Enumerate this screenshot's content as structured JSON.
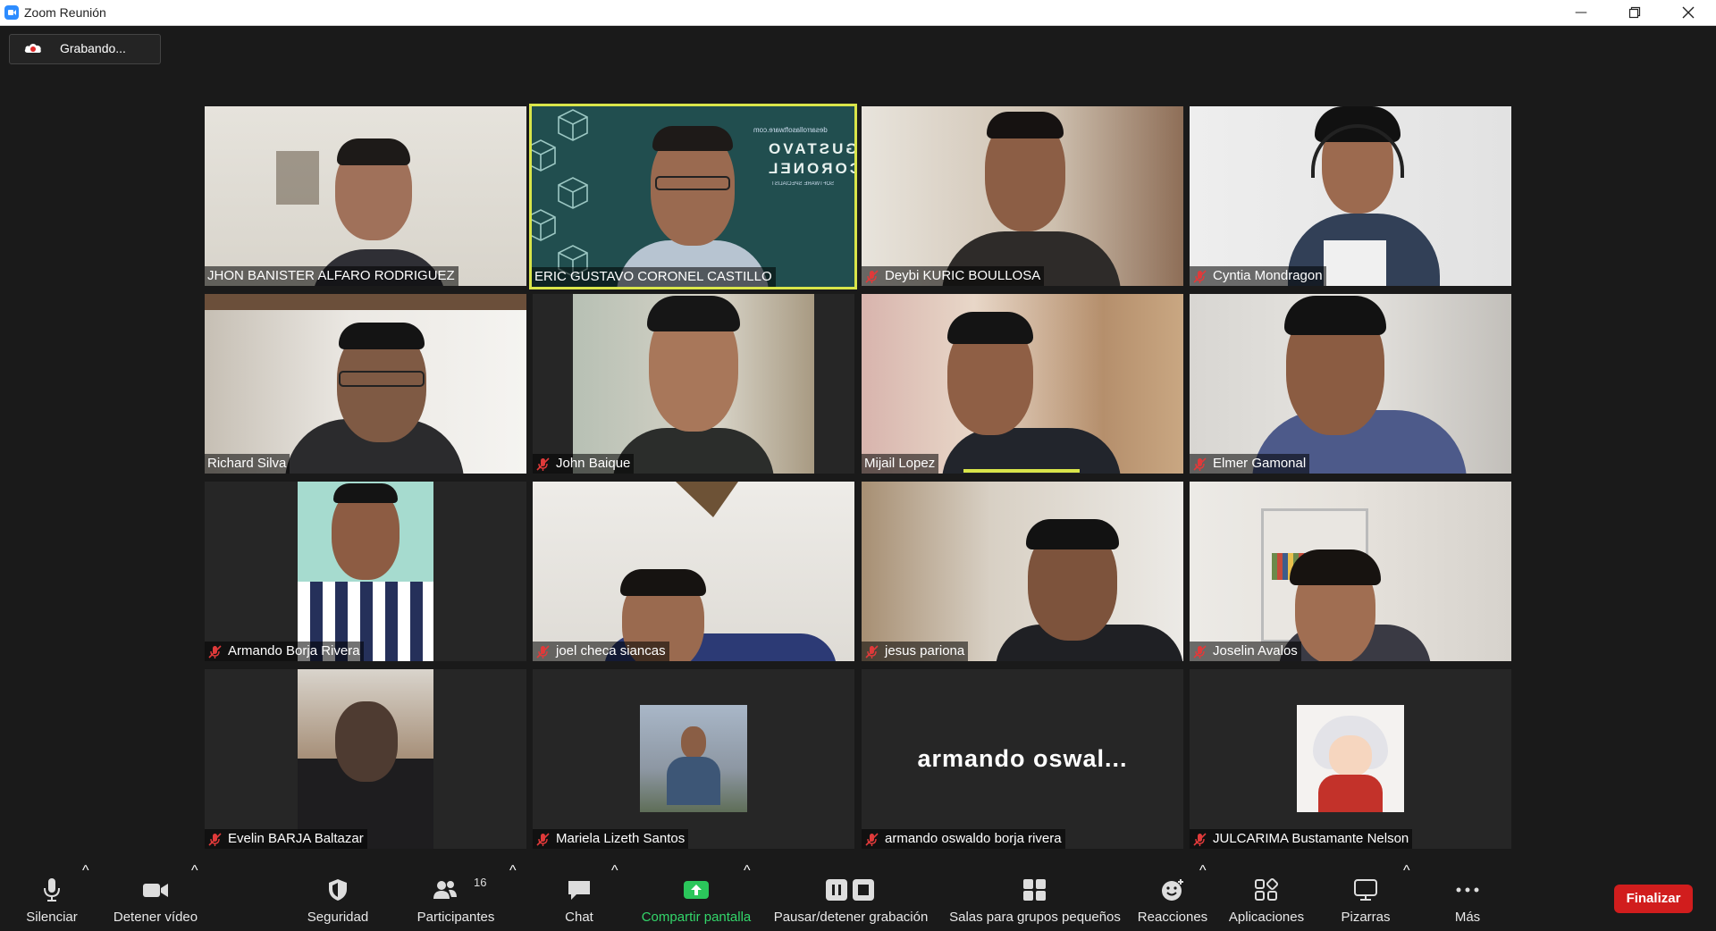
{
  "window": {
    "title": "Zoom Reunión"
  },
  "recording_badge": {
    "label": "Grabando..."
  },
  "participants": [
    {
      "name": "JHON BANISTER ALFARO RODRIGUEZ",
      "muted": false
    },
    {
      "name": "ERIC GUSTAVO CORONEL CASTILLO",
      "muted": false,
      "speaking": true
    },
    {
      "name": "Deybi KURIC BOULLOSA",
      "muted": true
    },
    {
      "name": "Cyntia Mondragon",
      "muted": true
    },
    {
      "name": "Richard Silva",
      "muted": false
    },
    {
      "name": "John Baique",
      "muted": true
    },
    {
      "name": "Mijail Lopez",
      "muted": false
    },
    {
      "name": "Elmer Gamonal",
      "muted": true
    },
    {
      "name": "Armando Borja Rivera",
      "muted": true
    },
    {
      "name": "joel checa siancas",
      "muted": true
    },
    {
      "name": "jesus pariona",
      "muted": true
    },
    {
      "name": "Joselin Avalos",
      "muted": true
    },
    {
      "name": "Evelin BARJA  Baltazar",
      "muted": true
    },
    {
      "name": "Mariela Lizeth Santos",
      "muted": true
    },
    {
      "name": "armando oswaldo borja rivera",
      "muted": true,
      "video_off_label": "armando  oswal..."
    },
    {
      "name": "JULCARIMA Bustamante Nelson",
      "muted": true
    }
  ],
  "virtual_background": {
    "brand": "desarrollasoftware.com",
    "line1": "GUSTAVO",
    "line2": "CORONEL",
    "line3": "SOFTWARE SPECIALIST"
  },
  "toolbar": {
    "mute": "Silenciar",
    "video": "Detener vídeo",
    "security": "Seguridad",
    "participants": "Participantes",
    "participants_count": "16",
    "chat": "Chat",
    "share": "Compartir pantalla",
    "recording": "Pausar/detener grabación",
    "breakout": "Salas para grupos pequeños",
    "reactions": "Reacciones",
    "apps": "Aplicaciones",
    "whiteboards": "Pizarras",
    "more": "Más",
    "end": "Finalizar"
  },
  "colors": {
    "speaker_border": "#d9e54a",
    "share_green": "#33d66a",
    "end_red": "#d11d1d",
    "muted_red": "#e03a3a"
  }
}
